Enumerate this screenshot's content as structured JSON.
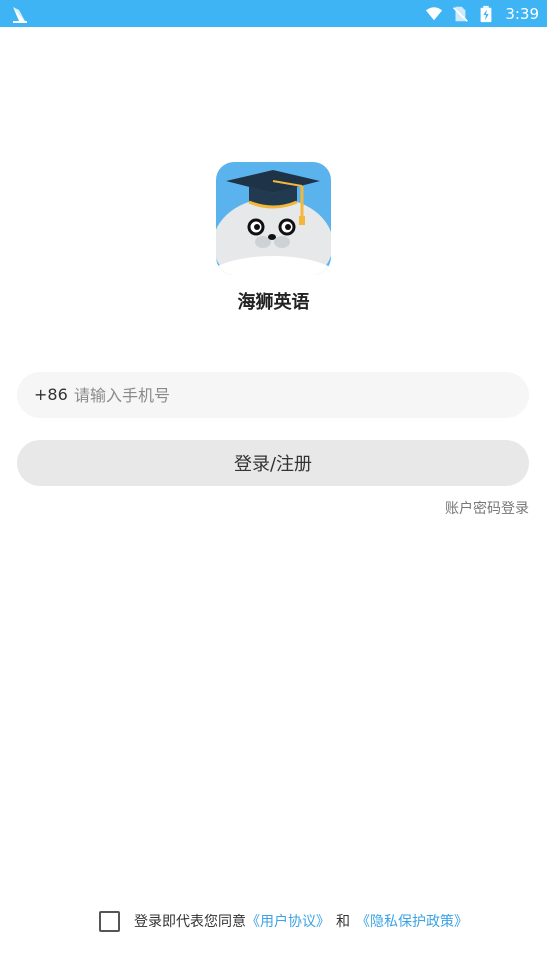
{
  "status_bar": {
    "time": "3:39",
    "icons": [
      "notification-app-icon",
      "wifi-icon",
      "no-sim-icon",
      "battery-charging-icon"
    ],
    "color": "#3eb4f5"
  },
  "app": {
    "name": "海狮英语",
    "logo_icon": "sea-lion-graduation-cap-logo"
  },
  "phone": {
    "country_code": "+86",
    "placeholder": "请输入手机号",
    "value": ""
  },
  "login_button": {
    "label": "登录/注册"
  },
  "password_login": {
    "label": "账户密码登录"
  },
  "agreement": {
    "prefix": "登录即代表您同意",
    "user_agreement": "《用户协议》",
    "and": "和",
    "privacy_policy": "《隐私保护政策》",
    "checked": false
  },
  "colors": {
    "link": "#3ca3e4",
    "button_bg": "#e8e8e8",
    "field_bg": "#f6f6f6"
  }
}
